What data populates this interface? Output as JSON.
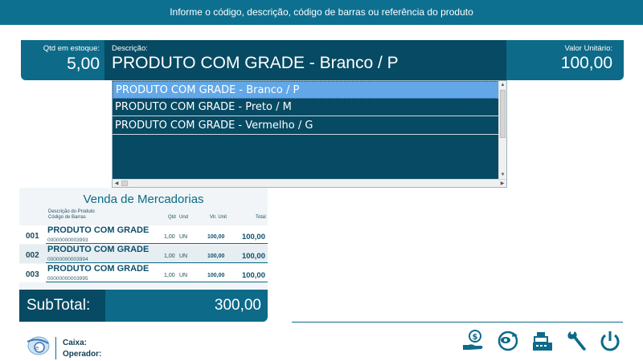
{
  "header": {
    "prompt": "Informe o código, descrição, código de barras ou referência do produto"
  },
  "entry": {
    "qty_label": "Qtd em estoque:",
    "qty_value": "5,00",
    "desc_label": "Descrição:",
    "desc_value": "PRODUTO COM GRADE - Branco / P",
    "unit_label": "Valor Unitário:",
    "unit_value": "100,00"
  },
  "dropdown": {
    "items": [
      "PRODUTO COM GRADE - Branco / P",
      "PRODUTO COM GRADE - Preto / M",
      "PRODUTO COM GRADE - Vermelho / G"
    ]
  },
  "sales": {
    "title": "Venda de Mercadorias",
    "headers": {
      "desc": "Descrição do Produto",
      "barcode": "Código de Barras",
      "qtd": "Qtd",
      "und": "Und",
      "vlr": "Vlr. Unit",
      "total": "Total"
    },
    "rows": [
      {
        "num": "001",
        "name": "PRODUTO COM GRADE",
        "code": "00000000003993",
        "qtd": "1,00",
        "und": "UN",
        "vu": "100,00",
        "total": "100,00"
      },
      {
        "num": "002",
        "name": "PRODUTO COM GRADE",
        "code": "00000000003994",
        "qtd": "1,00",
        "und": "UN",
        "vu": "100,00",
        "total": "100,00"
      },
      {
        "num": "003",
        "name": "PRODUTO COM GRADE",
        "code": "00000000003995",
        "qtd": "1,00",
        "und": "UN",
        "vu": "100,00",
        "total": "100,00"
      }
    ]
  },
  "subtotal": {
    "label": "SubTotal:",
    "value": "300,00"
  },
  "footer": {
    "caixa_label": "Caixa:",
    "operador_label": "Operador:"
  },
  "colors": {
    "primary": "#0d6a89",
    "dark": "#074a63",
    "selected": "#62a8e8"
  }
}
